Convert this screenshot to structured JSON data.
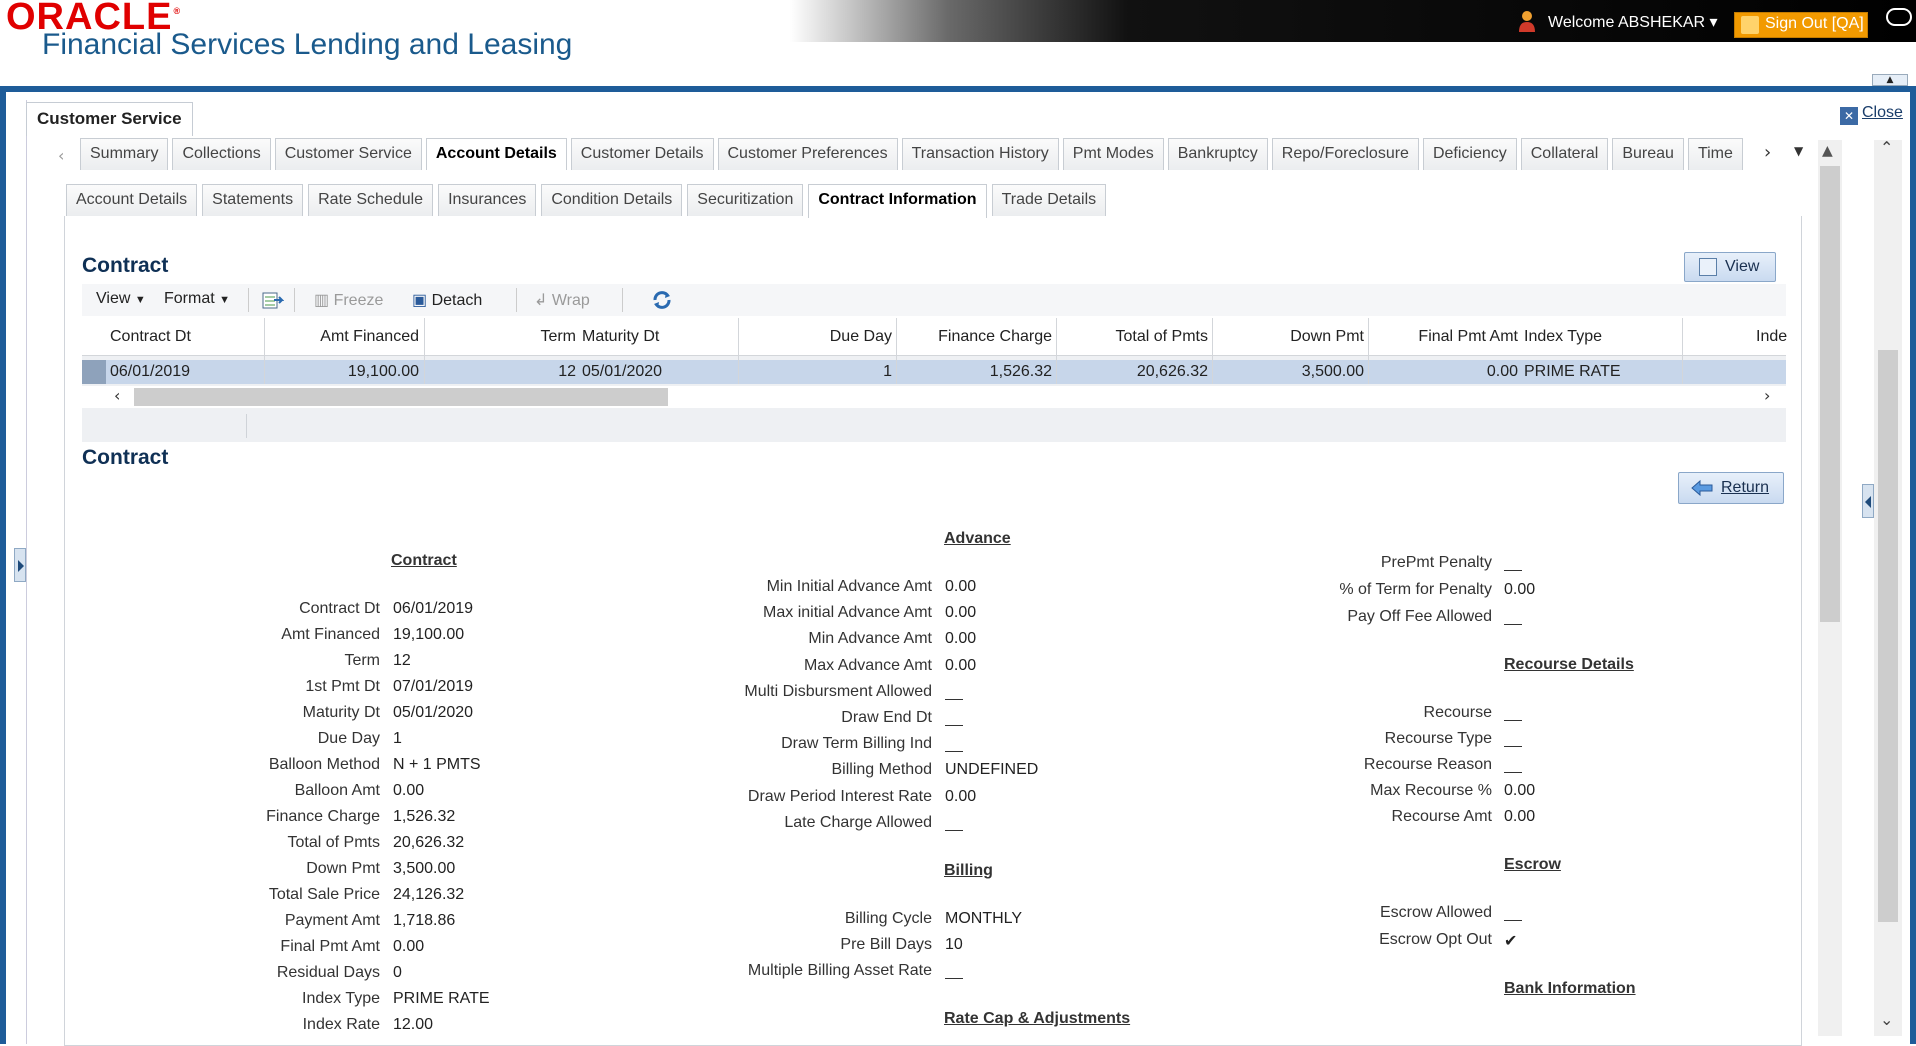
{
  "header": {
    "brand": "ORACLE",
    "product": "Financial Services Lending and Leasing",
    "welcome": "Welcome ABSHEKAR",
    "sign_out": "Sign Out [QA]"
  },
  "panel": {
    "title": "Customer Service",
    "close": "Close"
  },
  "tabs": [
    "Summary",
    "Collections",
    "Customer Service",
    "Account Details",
    "Customer Details",
    "Customer Preferences",
    "Transaction History",
    "Pmt Modes",
    "Bankruptcy",
    "Repo/Foreclosure",
    "Deficiency",
    "Collateral",
    "Bureau",
    "Time"
  ],
  "active_tab": "Account Details",
  "subtabs": [
    "Account Details",
    "Statements",
    "Rate Schedule",
    "Insurances",
    "Condition Details",
    "Securitization",
    "Contract Information",
    "Trade Details"
  ],
  "active_subtab": "Contract Information",
  "contract_section": {
    "title": "Contract",
    "view_button": "View",
    "toolbar": {
      "view": "View",
      "format": "Format",
      "freeze": "Freeze",
      "detach": "Detach",
      "wrap": "Wrap"
    },
    "columns": [
      "Contract Dt",
      "Amt Financed",
      "Term",
      "Maturity Dt",
      "Due Day",
      "Finance Charge",
      "Total of Pmts",
      "Down Pmt",
      "Final Pmt Amt",
      "Index Type",
      "Inde"
    ],
    "row": [
      "06/01/2019",
      "19,100.00",
      "12",
      "05/01/2020",
      "1",
      "1,526.32",
      "20,626.32",
      "3,500.00",
      "0.00",
      "PRIME RATE",
      ""
    ]
  },
  "detail": {
    "title": "Contract",
    "return_button": "Return",
    "contract_heading": "Contract",
    "contract_fields": [
      {
        "label": "Contract Dt",
        "value": "06/01/2019"
      },
      {
        "label": "Amt Financed",
        "value": "19,100.00"
      },
      {
        "label": "Term",
        "value": "12"
      },
      {
        "label": "1st Pmt Dt",
        "value": "07/01/2019"
      },
      {
        "label": "Maturity Dt",
        "value": "05/01/2020"
      },
      {
        "label": "Due Day",
        "value": "1"
      },
      {
        "label": "Balloon Method",
        "value": "N + 1 PMTS"
      },
      {
        "label": "Balloon Amt",
        "value": "0.00"
      },
      {
        "label": "Finance Charge",
        "value": "1,526.32"
      },
      {
        "label": "Total of Pmts",
        "value": "20,626.32"
      },
      {
        "label": "Down Pmt",
        "value": "3,500.00"
      },
      {
        "label": "Total Sale Price",
        "value": "24,126.32"
      },
      {
        "label": "Payment Amt",
        "value": "1,718.86"
      },
      {
        "label": "Final Pmt Amt",
        "value": "0.00"
      },
      {
        "label": "Residual Days",
        "value": "0"
      },
      {
        "label": "Index Type",
        "value": "PRIME RATE"
      },
      {
        "label": "Index Rate",
        "value": "12.00"
      }
    ],
    "advance_heading": "Advance",
    "advance_fields": [
      {
        "label": "Min Initial Advance Amt",
        "value": "0.00"
      },
      {
        "label": "Max initial Advance Amt",
        "value": "0.00"
      },
      {
        "label": "Min Advance Amt",
        "value": "0.00"
      },
      {
        "label": "Max Advance Amt",
        "value": "0.00"
      },
      {
        "label": "Multi Disbursment Allowed",
        "value": ""
      },
      {
        "label": "Draw End Dt",
        "value": ""
      },
      {
        "label": "Draw Term Billing Ind",
        "value": ""
      },
      {
        "label": "Billing Method",
        "value": "UNDEFINED"
      },
      {
        "label": "Draw Period Interest Rate",
        "value": "0.00"
      },
      {
        "label": "Late Charge Allowed",
        "value": ""
      }
    ],
    "billing_heading": "Billing",
    "billing_fields": [
      {
        "label": "Billing Cycle",
        "value": "MONTHLY"
      },
      {
        "label": "Pre Bill Days",
        "value": "10"
      },
      {
        "label": "Multiple Billing Asset Rate",
        "value": ""
      }
    ],
    "rate_cap_heading": "Rate Cap & Adjustments",
    "prepay_fields": [
      {
        "label": "PrePmt Penalty",
        "value": ""
      },
      {
        "label": "% of Term for Penalty",
        "value": "0.00"
      },
      {
        "label": "Pay Off Fee Allowed",
        "value": ""
      }
    ],
    "recourse_heading": "Recourse Details",
    "recourse_fields": [
      {
        "label": "Recourse",
        "value": ""
      },
      {
        "label": "Recourse Type",
        "value": ""
      },
      {
        "label": "Recourse Reason",
        "value": ""
      },
      {
        "label": "Max Recourse %",
        "value": "0.00"
      },
      {
        "label": "Recourse Amt",
        "value": "0.00"
      }
    ],
    "escrow_heading": "Escrow",
    "escrow_fields": [
      {
        "label": "Escrow Allowed",
        "value": ""
      },
      {
        "label": "Escrow Opt Out",
        "value": "✔"
      }
    ],
    "bank_heading": "Bank Information"
  }
}
